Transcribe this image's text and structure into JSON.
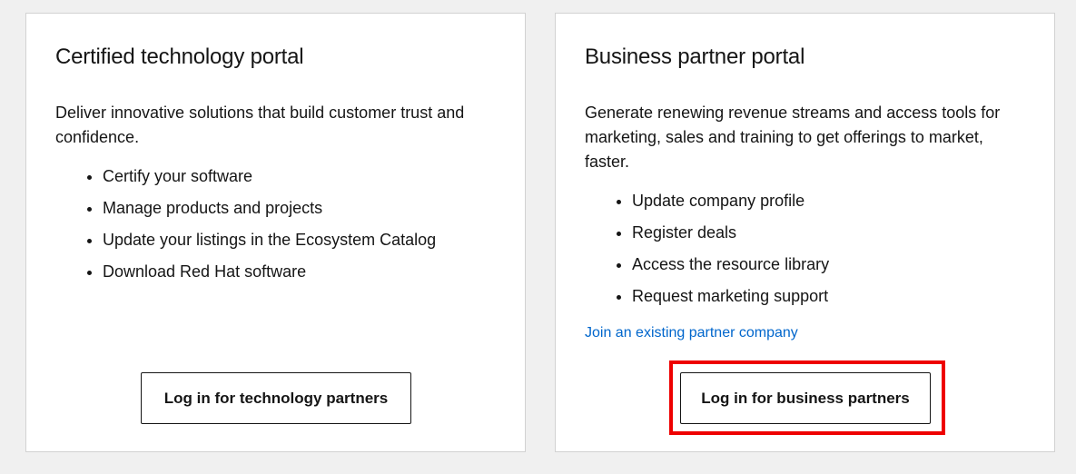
{
  "tech_card": {
    "title": "Certified technology portal",
    "description": "Deliver innovative solutions that build customer trust and confidence.",
    "items": [
      "Certify your software",
      "Manage products and projects",
      "Update your listings in the Ecosystem Catalog",
      "Download Red Hat software"
    ],
    "button_label": "Log in for technology partners"
  },
  "biz_card": {
    "title": "Business partner portal",
    "description": "Generate renewing revenue streams and access tools for marketing, sales and training to get offerings to market, faster.",
    "items": [
      "Update company profile",
      "Register deals",
      "Access the resource library",
      "Request marketing support"
    ],
    "join_link": "Join an existing partner company",
    "button_label": "Log in for business partners"
  },
  "colors": {
    "link": "#0066cc",
    "highlight": "#ee0000",
    "background": "#f0f0f0"
  }
}
